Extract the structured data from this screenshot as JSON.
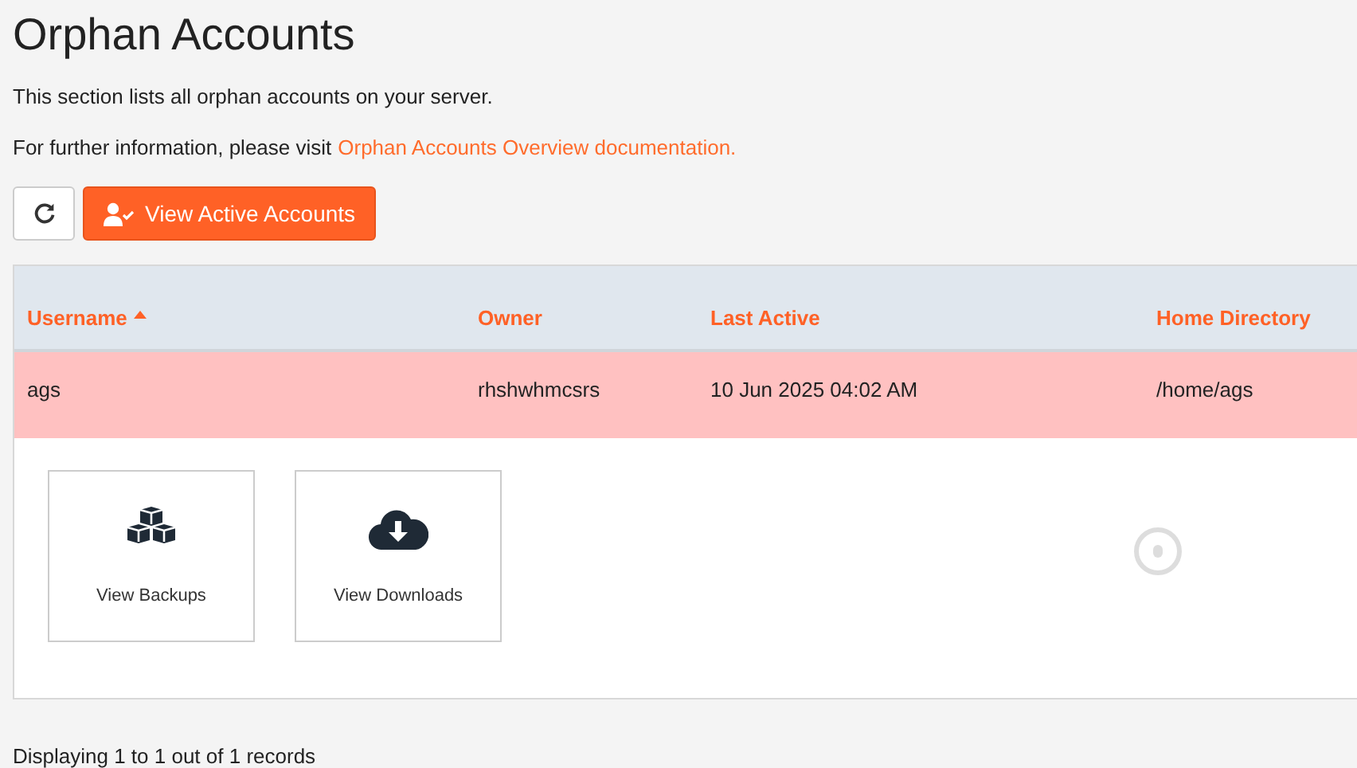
{
  "title": "Orphan Accounts",
  "intro": "This section lists all orphan accounts on your server.",
  "info": {
    "text": "For further information, please visit",
    "link": "Orphan Accounts Overview documentation."
  },
  "toolbar": {
    "primary_button": "View Active Accounts"
  },
  "table": {
    "columns": [
      {
        "label": "Username",
        "sorted": true
      },
      {
        "label": "Owner",
        "sorted": false
      },
      {
        "label": "Last Active",
        "sorted": false
      },
      {
        "label": "Home Directory",
        "sorted": false
      }
    ],
    "rows": [
      {
        "cells": [
          "ags",
          "rhshwhmcsrs",
          "10 Jun 2025 04:02 AM",
          "/home/ags"
        ],
        "expanded": true,
        "actions": [
          {
            "kind": "backups",
            "label": "View Backups"
          },
          {
            "kind": "downloads",
            "label": "View Downloads"
          }
        ],
        "loading": true
      }
    ]
  },
  "footer": "Displaying 1 to 1 out of 1 records"
}
